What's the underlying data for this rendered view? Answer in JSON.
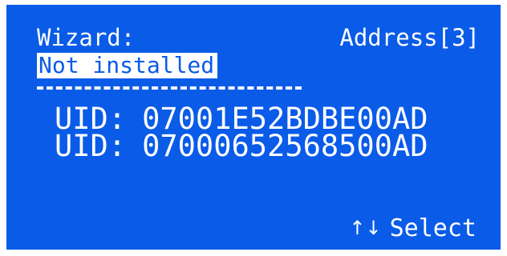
{
  "header": {
    "title": "Wizard:",
    "address": "Address[3]",
    "status": "Not installed",
    "divider": "--------------------"
  },
  "uid_list": [
    {
      "prefix": "UID:",
      "value": "07001E52BDBE00AD"
    },
    {
      "prefix": "UID:",
      "value": "07000652568500AD"
    }
  ],
  "footer": {
    "arrows": "↑↓",
    "select_label": "Select"
  },
  "colors": {
    "screen_background": "#0a5be8",
    "text": "#ffffff"
  }
}
